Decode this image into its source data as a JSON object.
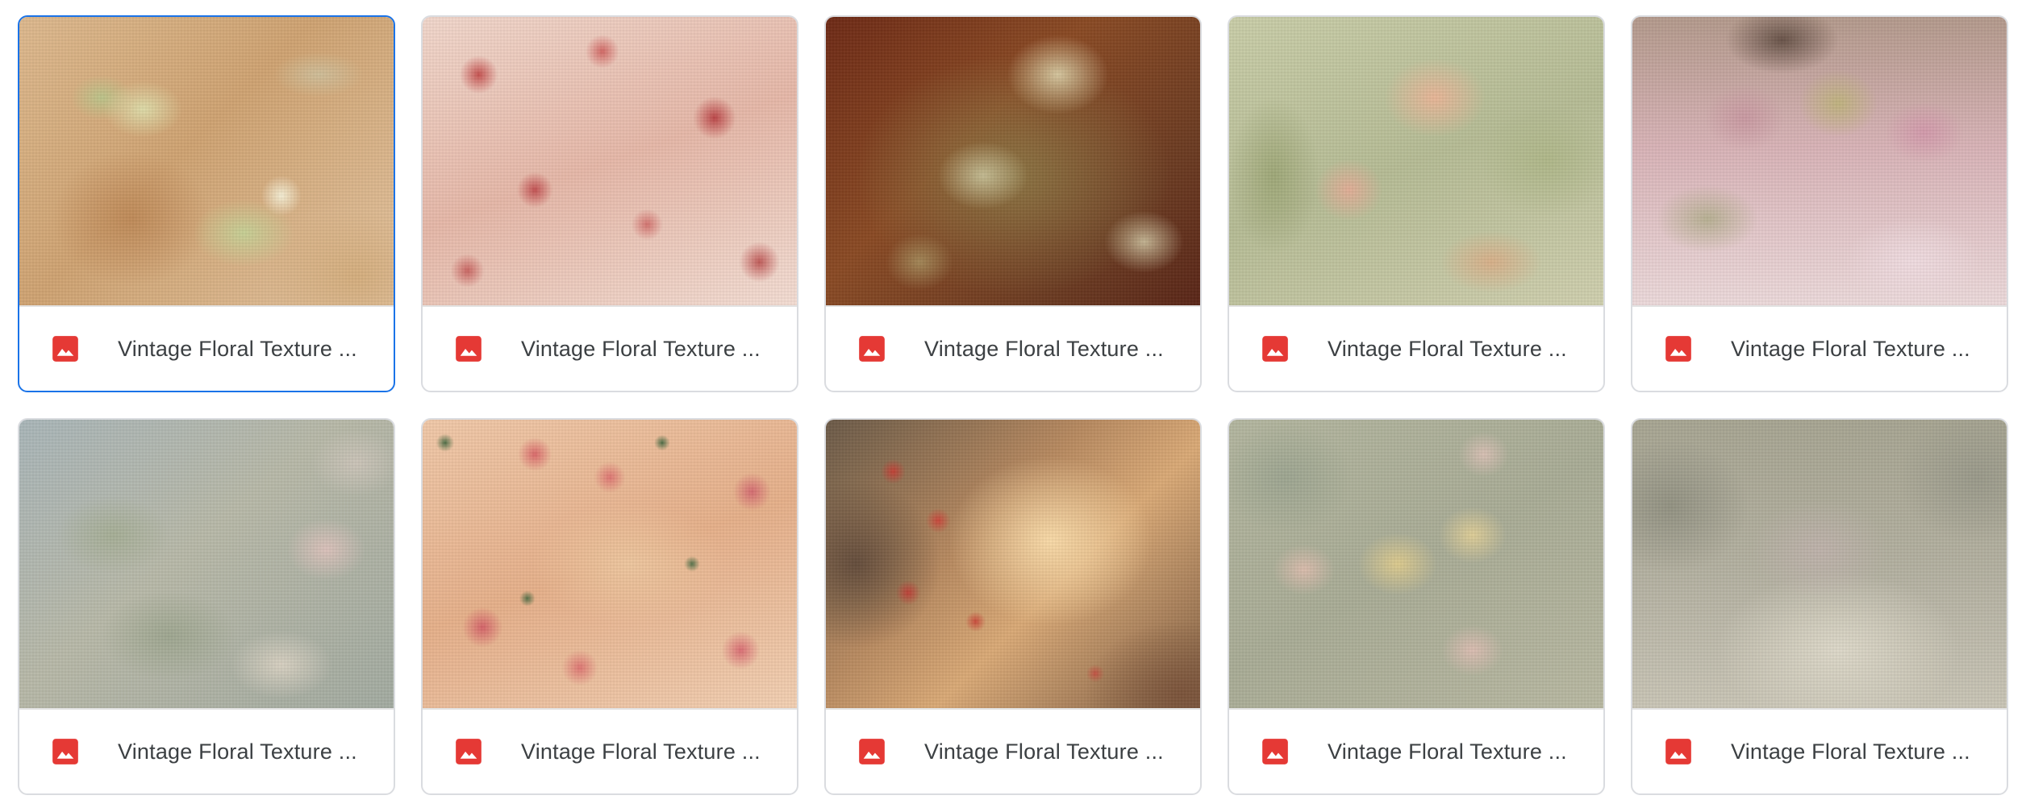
{
  "files": [
    {
      "name": "Vintage Floral Texture ...",
      "icon": "image-file-icon",
      "selected": true
    },
    {
      "name": "Vintage Floral Texture ...",
      "icon": "image-file-icon",
      "selected": false
    },
    {
      "name": "Vintage Floral Texture ...",
      "icon": "image-file-icon",
      "selected": false
    },
    {
      "name": "Vintage Floral Texture ...",
      "icon": "image-file-icon",
      "selected": false
    },
    {
      "name": "Vintage Floral Texture ...",
      "icon": "image-file-icon",
      "selected": false
    },
    {
      "name": "Vintage Floral Texture ...",
      "icon": "image-file-icon",
      "selected": false
    },
    {
      "name": "Vintage Floral Texture ...",
      "icon": "image-file-icon",
      "selected": false
    },
    {
      "name": "Vintage Floral Texture ...",
      "icon": "image-file-icon",
      "selected": false
    },
    {
      "name": "Vintage Floral Texture ...",
      "icon": "image-file-icon",
      "selected": false
    },
    {
      "name": "Vintage Floral Texture ...",
      "icon": "image-file-icon",
      "selected": false
    }
  ],
  "colors": {
    "selected_border": "#1a73e8",
    "card_border": "#dadce0",
    "file_icon": "#e53935",
    "file_name_text": "#3c4043"
  }
}
